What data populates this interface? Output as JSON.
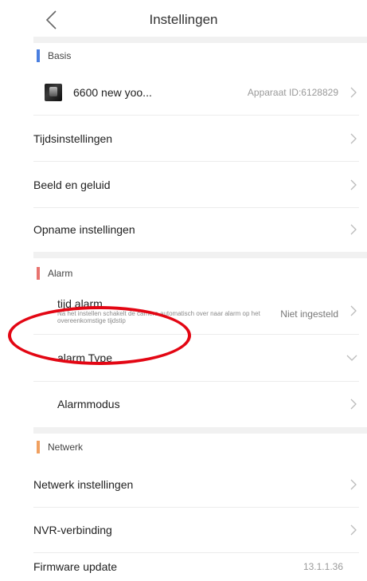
{
  "header": {
    "title": "Instellingen"
  },
  "sections": {
    "basis": {
      "label": "Basis",
      "color": "#4a7fe0"
    },
    "alarm": {
      "label": "Alarm",
      "color": "#e8736f"
    },
    "netwerk": {
      "label": "Netwerk",
      "color": "#f0a060"
    }
  },
  "basis_rows": {
    "device_name": "6600 new yoo...",
    "device_id": "Apparaat ID:6128829",
    "time_settings": "Tijdsinstellingen",
    "image_sound": "Beeld en geluid",
    "recording_settings": "Opname instellingen"
  },
  "alarm_rows": {
    "time_alarm": "tijd alarm",
    "time_alarm_desc": "Na het instellen schakelt de camera automatisch over naar alarm op het overeenkomstige tijdstip",
    "time_alarm_value": "Niet ingesteld",
    "alarm_type": "alarm Type",
    "alarm_mode": "Alarmmodus"
  },
  "netwerk_rows": {
    "network_settings": "Netwerk instellingen",
    "nvr_connection": "NVR-verbinding",
    "firmware_update": "Firmware update",
    "firmware_version": "13.1.1.36"
  },
  "annotation": {
    "color": "#e30613"
  }
}
